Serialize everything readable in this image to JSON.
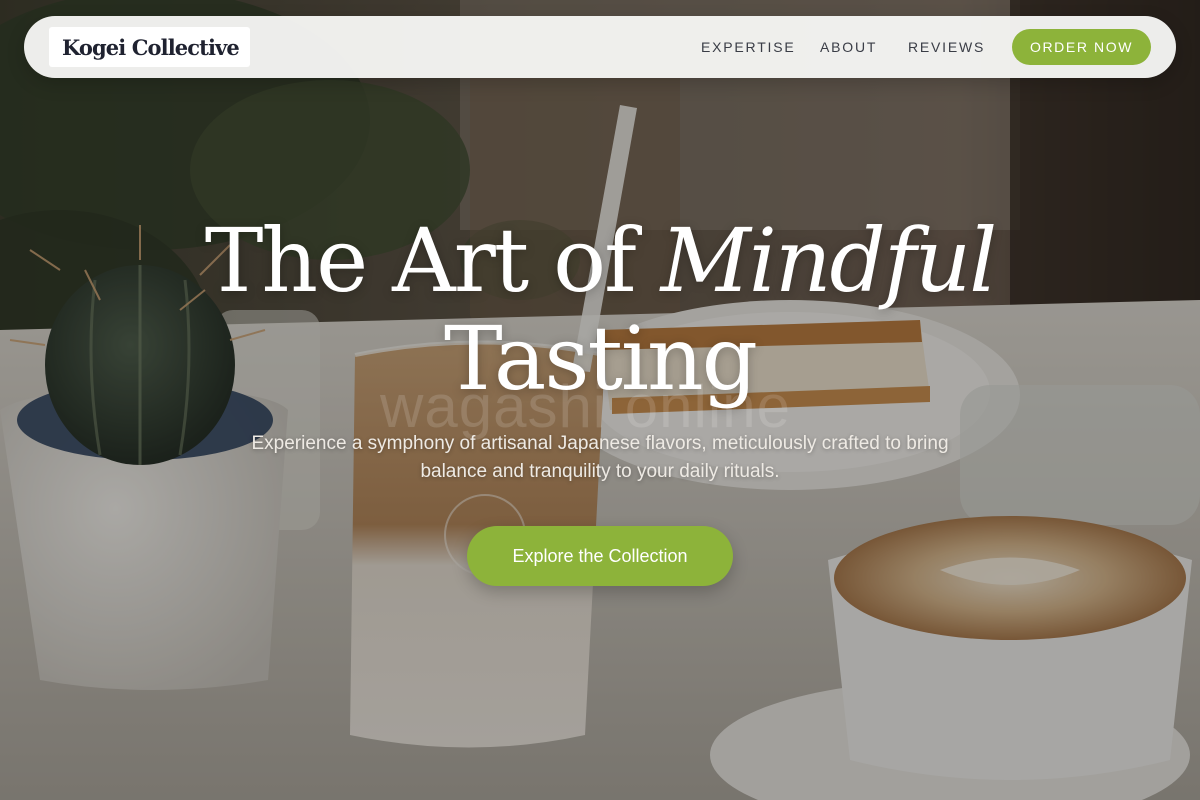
{
  "nav": {
    "brand": "Kogei Collective",
    "links": [
      "EXPERTISE",
      "ABOUT",
      "REVIEWS"
    ],
    "order_button": "ORDER NOW"
  },
  "hero": {
    "title_prefix": "The Art of ",
    "title_accent": "Mindful",
    "title_suffix": "Tasting",
    "watermark": "wagashi online",
    "subtitle": "Experience a symphony of artisanal Japanese flavors, meticulously crafted to bring balance and tranquility to your daily rituals.",
    "cta_label": "Explore the Collection"
  },
  "colors": {
    "accent": "#8db33a",
    "nav_background": "#f6f6f4",
    "nav_text": "#3a3d46",
    "brand_text": "#1f2230",
    "hero_text": "#ffffff"
  }
}
